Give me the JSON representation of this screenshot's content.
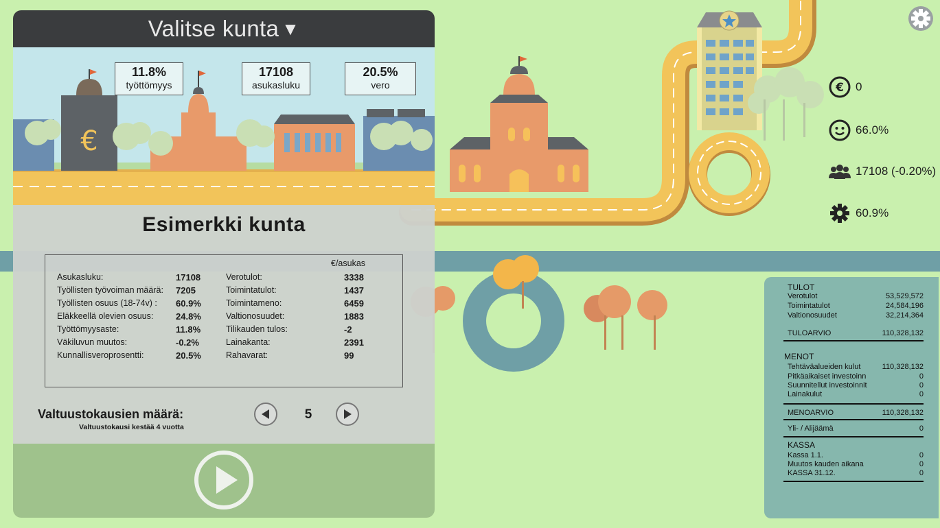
{
  "header": {
    "title": "Valitse kunta",
    "caret": "▼"
  },
  "bubbles": [
    {
      "value": "11.8%",
      "label": "työttömyys"
    },
    {
      "value": "17108",
      "label": "asukasluku"
    },
    {
      "value": "20.5%",
      "label": "vero"
    }
  ],
  "town": {
    "name": "Esimerkki kunta"
  },
  "stats": {
    "per_resident_header": "€/asukas",
    "left": [
      {
        "label": "Asukasluku:",
        "value": "17108"
      },
      {
        "label": "Työllisten työvoiman määrä:",
        "value": "7205"
      },
      {
        "label": "Työllisten osuus (18-74v) :",
        "value": "60.9%"
      },
      {
        "label": "Eläkkeellä olevien osuus:",
        "value": "24.8%"
      },
      {
        "label": "Työttömyysaste:",
        "value": "11.8%"
      },
      {
        "label": "Väkiluvun muutos:",
        "value": "-0.2%"
      },
      {
        "label": "Kunnallisveroprosentti:",
        "value": "20.5%"
      }
    ],
    "right": [
      {
        "label": "Verotulot:",
        "value": "3338"
      },
      {
        "label": "Toimintatulot:",
        "value": "1437"
      },
      {
        "label": "Toimintameno:",
        "value": "6459"
      },
      {
        "label": "Valtionosuudet:",
        "value": "1883"
      },
      {
        "label": "Tilikauden tulos:",
        "value": "-2"
      },
      {
        "label": "Lainakanta:",
        "value": "2391"
      },
      {
        "label": "Rahavarat:",
        "value": "99"
      }
    ]
  },
  "terms": {
    "label": "Valtuustokausien määrä:",
    "sublabel": "Valtuustokausi kestää 4 vuotta",
    "value": "5"
  },
  "hud": {
    "money": "0",
    "happiness": "66.0%",
    "population": "17108 (-0.20%)",
    "employment": "60.9%"
  },
  "budget": {
    "tulot_title": "TULOT",
    "tulot": [
      {
        "label": "Verotulot",
        "value": "53,529,572"
      },
      {
        "label": "Toimintatulot",
        "value": "24,584,196"
      },
      {
        "label": "Valtionosuudet",
        "value": "32,214,364"
      }
    ],
    "tuloarvio": {
      "label": "TULOARVIO",
      "value": "110,328,132"
    },
    "menot_title": "MENOT",
    "menot": [
      {
        "label": "Tehtäväalueiden kulut",
        "value": "110,328,132"
      },
      {
        "label": "Pitkäaikaiset investoinn",
        "value": "0"
      },
      {
        "label": "Suunnitellut investoinnit",
        "value": "0"
      },
      {
        "label": "Lainakulut",
        "value": "0"
      }
    ],
    "menoarvio": {
      "label": "MENOARVIO",
      "value": "110,328,132"
    },
    "ylijaama": {
      "label": "Yli- / Alijäämä",
      "value": "0"
    },
    "kassa_title": "KASSA",
    "kassa": [
      {
        "label": "Kassa 1.1.",
        "value": "0"
      },
      {
        "label": "Muutos kauden aikana",
        "value": "0"
      },
      {
        "label": "KASSA 31.12.",
        "value": "0"
      }
    ]
  },
  "colors": {
    "grass": "#c9f0ae",
    "road": "#f2c45a",
    "water": "#6f9fa6",
    "header": "#3a3c3e",
    "panel": "#86b7ad"
  },
  "icons": {
    "settings": "gear-icon",
    "money": "euro-icon",
    "happiness": "smiley-icon",
    "population": "people-icon",
    "employment": "cog-icon",
    "play": "play-icon",
    "prev": "arrow-left-icon",
    "next": "arrow-right-icon"
  }
}
